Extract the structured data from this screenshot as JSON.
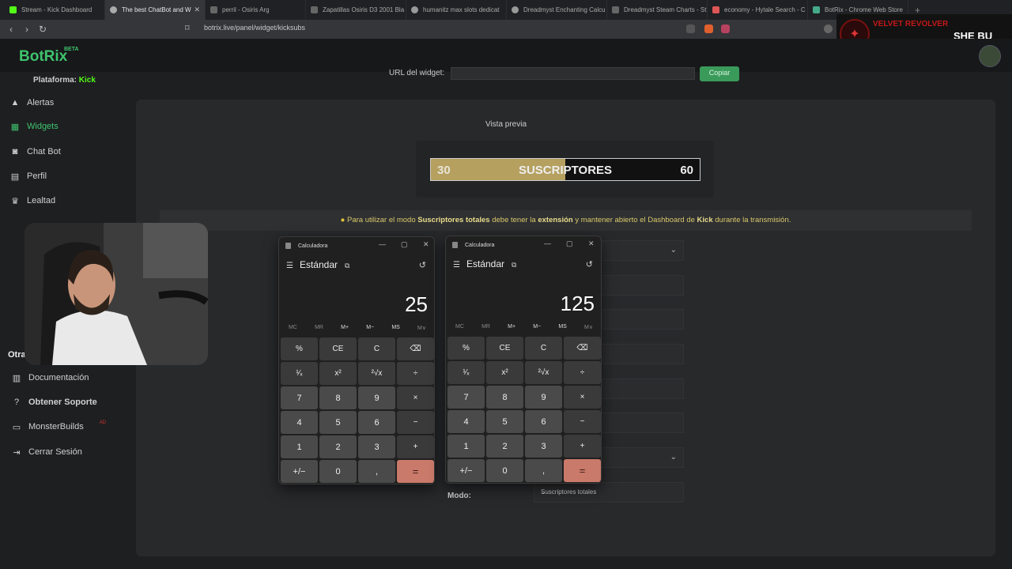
{
  "browser": {
    "tabs": [
      {
        "title": "Stream - Kick Dashboard",
        "active": false
      },
      {
        "title": "The best ChatBot and W",
        "active": true
      },
      {
        "title": "perril - Osiris Arg",
        "active": false
      },
      {
        "title": "Zapatillas Osiris D3 2001 Bla",
        "active": false
      },
      {
        "title": "humanitz max slots dedicat",
        "active": false
      },
      {
        "title": "Dreadmyst Enchanting Calcu",
        "active": false
      },
      {
        "title": "Dreadmyst Steam Charts - St",
        "active": false
      },
      {
        "title": "economy - Hytale Search - C",
        "active": false
      },
      {
        "title": "BotRix - Chrome Web Store",
        "active": false
      }
    ],
    "new_tab": "+",
    "url": "botrix.live/panel/widget/kicksubs"
  },
  "overlay": {
    "song_line1": "VELVET REVOLVER",
    "song_line2": "SHE BU"
  },
  "brand": {
    "name": "BotRix",
    "badge": "BETA"
  },
  "sidebar": {
    "platform_label": "Plataforma:",
    "platform_value": "Kick",
    "items": [
      {
        "label": "Alertas",
        "icon": "warning-icon"
      },
      {
        "label": "Widgets",
        "icon": "grid-icon",
        "active": true
      },
      {
        "label": "Chat Bot",
        "icon": "robot-icon"
      },
      {
        "label": "Perfil",
        "icon": "id-card-icon"
      },
      {
        "label": "Lealtad",
        "icon": "trophy-icon"
      }
    ],
    "section_other": "Otra",
    "other_items": [
      {
        "label": "Documentación",
        "icon": "book-icon"
      },
      {
        "label": "Obtener Soporte",
        "icon": "question-icon"
      },
      {
        "label": "MonsterBuilds",
        "icon": "laptop-icon",
        "badge": "AD"
      },
      {
        "label": "Cerrar Sesión",
        "icon": "logout-icon"
      }
    ]
  },
  "widget": {
    "url_label": "URL del widget:",
    "copy_button": "Copiar",
    "preview_title": "Vista previa",
    "bar": {
      "current": "30",
      "label": "SUSCRIPTORES",
      "goal": "60",
      "progress": 0.5
    },
    "notice": {
      "p1": "Para utilizar el modo ",
      "b1": "Suscriptores totales",
      "p2": " debe tener la ",
      "b2": "extensión",
      "p3": " y mantener abierto el Dashboard de ",
      "b3": "Kick",
      "p4": " durante la transmisión."
    },
    "mode_label": "Modo:",
    "mode_value": "Suscriptores totales"
  },
  "calculators": [
    {
      "title": "Calculadora",
      "mode": "Estándar",
      "display": "25",
      "memory": [
        "MC",
        "MR",
        "M+",
        "M−",
        "MS",
        "M∨"
      ],
      "keys": [
        "%",
        "CE",
        "C",
        "⌫",
        "¹⁄ₓ",
        "x²",
        "²√x",
        "÷",
        "7",
        "8",
        "9",
        "×",
        "4",
        "5",
        "6",
        "−",
        "1",
        "2",
        "3",
        "+",
        "+/−",
        "0",
        ",",
        "="
      ]
    },
    {
      "title": "Calculadora",
      "mode": "Estándar",
      "display": "125",
      "memory": [
        "MC",
        "MR",
        "M+",
        "M−",
        "MS",
        "M∨"
      ],
      "keys": [
        "%",
        "CE",
        "C",
        "⌫",
        "¹⁄ₓ",
        "x²",
        "²√x",
        "÷",
        "7",
        "8",
        "9",
        "×",
        "4",
        "5",
        "6",
        "−",
        "1",
        "2",
        "3",
        "+",
        "+/−",
        "0",
        ",",
        "="
      ]
    }
  ]
}
